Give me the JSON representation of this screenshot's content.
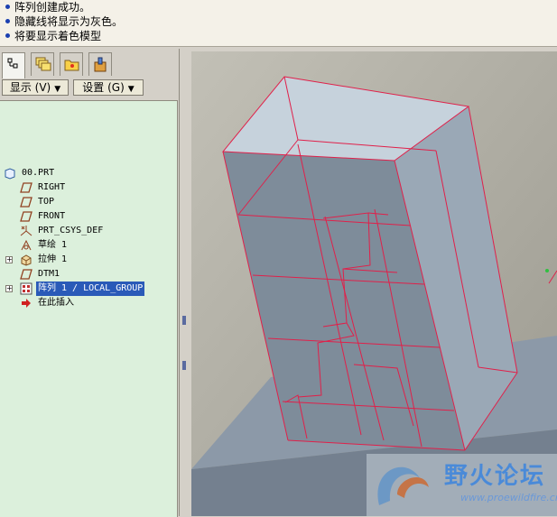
{
  "messages": [
    "阵列创建成功。",
    "隐藏线将显示为灰色。",
    "将要显示着色模型"
  ],
  "panel_tabs": [
    {
      "icon": "model-tree-icon",
      "active": true
    },
    {
      "icon": "layers-icon",
      "active": false
    },
    {
      "icon": "folder-browser-icon",
      "active": false
    },
    {
      "icon": "favorites-icon",
      "active": false
    }
  ],
  "buttons": {
    "show": "显示 (V)",
    "settings": "设置 (G)"
  },
  "model_tree": {
    "root": "00.PRT",
    "items": [
      {
        "label": "RIGHT",
        "icon": "datum-plane-icon",
        "expandable": false
      },
      {
        "label": "TOP",
        "icon": "datum-plane-icon",
        "expandable": false
      },
      {
        "label": "FRONT",
        "icon": "datum-plane-icon",
        "expandable": false
      },
      {
        "label": "PRT_CSYS_DEF",
        "icon": "csys-icon",
        "expandable": false
      },
      {
        "label": "草绘 1",
        "icon": "sketch-icon",
        "expandable": false
      },
      {
        "label": "拉伸 1",
        "icon": "extrude-icon",
        "expandable": true
      },
      {
        "label": "DTM1",
        "icon": "datum-plane-icon",
        "expandable": false
      },
      {
        "label": "阵列 1 / LOCAL_GROUP",
        "icon": "pattern-icon",
        "expandable": true,
        "selected": true
      },
      {
        "label": "在此插入",
        "icon": "insert-here-arrow-icon",
        "expandable": false
      }
    ]
  },
  "watermark": {
    "text": "野火论坛",
    "url": "www.proewildfire.cn"
  },
  "colors": {
    "edge": "#e0204a",
    "selection": "#2a5ab8",
    "tree_bg": "#dcf0dc",
    "viewport_bg": "#a8a498"
  }
}
